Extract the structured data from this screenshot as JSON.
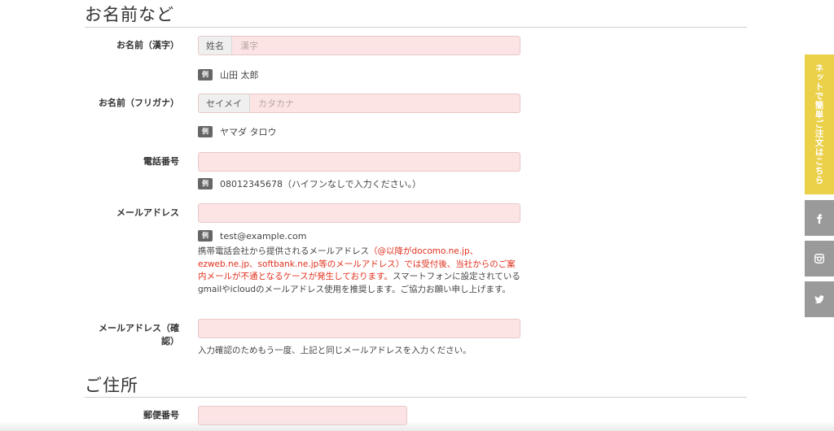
{
  "sections": {
    "name": "お名前など",
    "address": "ご住所"
  },
  "fields": {
    "name_kanji": {
      "label": "お名前（漢字）",
      "addon": "姓名",
      "placeholder": "漢字",
      "example": "山田 太郎"
    },
    "name_kana": {
      "label": "お名前（フリガナ）",
      "addon": "セイメイ",
      "placeholder": "カタカナ",
      "example": "ヤマダ タロウ"
    },
    "phone": {
      "label": "電話番号",
      "example": "08012345678（ハイフンなしで入力ください。）"
    },
    "email": {
      "label": "メールアドレス",
      "example": "test@example.com",
      "note_part1": "携帯電話会社から提供されるメールアドレス",
      "note_red": "（@以降がdocomo.ne.jp、ezweb.ne.jp、softbank.ne.jp等のメールアドレス）では受付後、当社からのご案内メールが不通となるケースが発生しております。",
      "note_part2": "スマートフォンに設定されているgmailやicloudのメールアドレス使用を推奨します。ご協力お願い申し上げます。"
    },
    "email_confirm": {
      "label_line1": "メールアドレス（確",
      "label_line2": "認）",
      "note": "入力確認のためもう一度、上記と同じメールアドレスを入力ください。"
    },
    "postal": {
      "label": "郵便番号"
    }
  },
  "example_badge": "例",
  "sidebar": {
    "order_label": "ネットで簡単ご注文はこちら",
    "icons": [
      "facebook-icon",
      "instagram-icon",
      "twitter-icon"
    ]
  },
  "colors": {
    "input_bg": "#fce4e4",
    "order_tab": "#ebd04a",
    "social_tab": "#9a9a9a",
    "warning_red": "#e0301e"
  }
}
